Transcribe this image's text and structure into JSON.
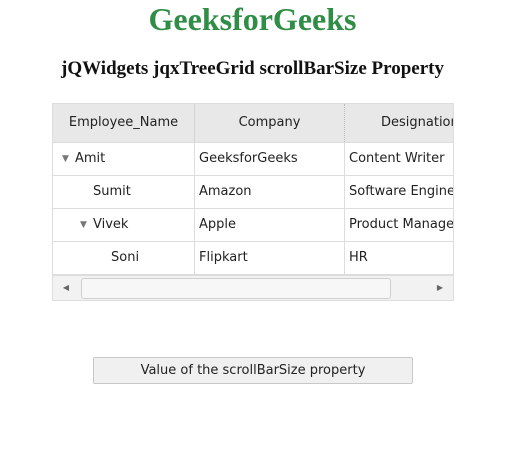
{
  "page": {
    "title": "GeeksforGeeks",
    "subtitle": "jQWidgets jqxTreeGrid scrollBarSize Property"
  },
  "grid": {
    "columns": [
      "Employee_Name",
      "Company",
      "Designation"
    ],
    "rows": [
      {
        "name": "Amit",
        "company": "GeeksforGeeks",
        "designation": "Content Writer",
        "level": 0,
        "expanded": true
      },
      {
        "name": "Sumit",
        "company": "Amazon",
        "designation": "Software Engineer",
        "level": 1
      },
      {
        "name": "Vivek",
        "company": "Apple",
        "designation": "Product Manager",
        "level": 1,
        "expanded": true
      },
      {
        "name": "Soni",
        "company": "Flipkart",
        "designation": "HR",
        "level": 2
      }
    ],
    "scroll_left_icon": "triangle-left-icon",
    "scroll_right_icon": "triangle-right-icon"
  },
  "button": {
    "label": "Value of the scrollBarSize property"
  },
  "colors": {
    "title": "#2f8d46",
    "header_bg": "#e8e8e8",
    "border": "#dddddd"
  }
}
